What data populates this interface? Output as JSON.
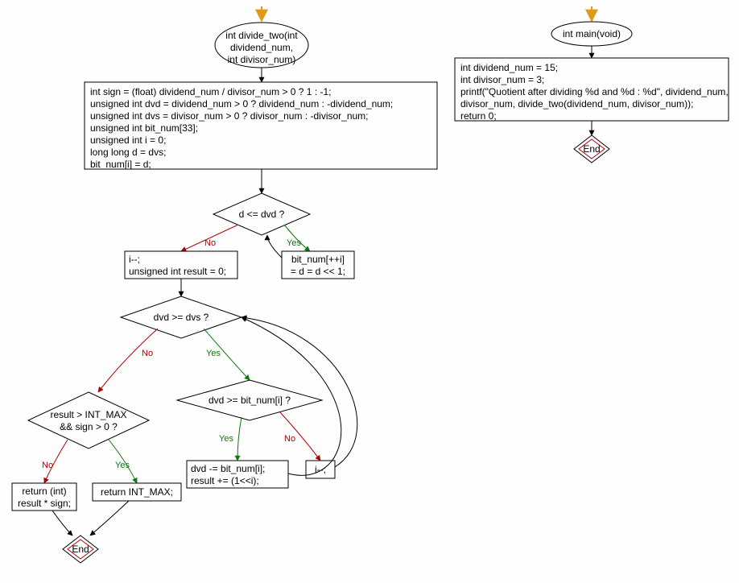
{
  "flowchart_left": {
    "start_arrow": "entry",
    "func_signature": "int divide_two(int\ndividend_num,\nint divisor_num)",
    "init_block": "int sign = (float) dividend_num / divisor_num > 0 ? 1 : -1;\nunsigned int dvd = dividend_num > 0 ? dividend_num : -dividend_num;\nunsigned int dvs = divisor_num > 0 ? divisor_num : -divisor_num;\nunsigned int bit_num[33];\nunsigned int i = 0;\nlong long d = dvs;\nbit_num[i] = d;",
    "cond1": "d <= dvd ?",
    "cond1_yes_block": "bit_num[++i]\n= d = d << 1;",
    "cond1_no_block": "i--;\nunsigned int result = 0;",
    "cond2": "dvd >= dvs ?",
    "cond3": "dvd >= bit_num[i] ?",
    "cond3_yes_block": "dvd -= bit_num[i];\nresult += (1<<i);",
    "cond3_no_block": "i--;",
    "cond4": "result > INT_MAX\n&& sign > 0 ?",
    "cond4_yes_block": "return INT_MAX;",
    "cond4_no_block": "return (int)\nresult * sign;",
    "end": "End"
  },
  "flowchart_right": {
    "func_signature": "int main(void)",
    "body_block": "int dividend_num = 15;\nint divisor_num = 3;\nprintf(\"Quotient after dividing %d and %d : %d\", dividend_num,\ndivisor_num, divide_two(dividend_num, divisor_num));\nreturn 0;",
    "end": "End"
  },
  "labels": {
    "yes": "Yes",
    "no": "No"
  },
  "colors": {
    "outline": "#000000",
    "fill_shape": "#fefefe",
    "yes": "#0a7a0a",
    "no": "#b00000",
    "entry_arrow": "#e09a1a",
    "end_inner": "#b00000"
  },
  "chart_data": {
    "type": "flowchart",
    "functions": [
      {
        "name": "int divide_two(int dividend_num, int divisor_num)",
        "nodes": [
          {
            "id": "init",
            "kind": "process",
            "text": "int sign = (float) dividend_num / divisor_num > 0 ? 1 : -1;\nunsigned int dvd = dividend_num > 0 ? dividend_num : -dividend_num;\nunsigned int dvs = divisor_num > 0 ? divisor_num : -divisor_num;\nunsigned int bit_num[33];\nunsigned int i = 0;\nlong long d = dvs;\nbit_num[i] = d;"
          },
          {
            "id": "c1",
            "kind": "decision",
            "text": "d <= dvd ?"
          },
          {
            "id": "c1y",
            "kind": "process",
            "text": "bit_num[++i] = d = d << 1;"
          },
          {
            "id": "c1n",
            "kind": "process",
            "text": "i--;\nunsigned int result = 0;"
          },
          {
            "id": "c2",
            "kind": "decision",
            "text": "dvd >= dvs ?"
          },
          {
            "id": "c3",
            "kind": "decision",
            "text": "dvd >= bit_num[i] ?"
          },
          {
            "id": "c3y",
            "kind": "process",
            "text": "dvd -= bit_num[i];\nresult += (1<<i);"
          },
          {
            "id": "c3n",
            "kind": "process",
            "text": "i--;"
          },
          {
            "id": "c4",
            "kind": "decision",
            "text": "result > INT_MAX && sign > 0 ?"
          },
          {
            "id": "c4y",
            "kind": "process",
            "text": "return INT_MAX;"
          },
          {
            "id": "c4n",
            "kind": "process",
            "text": "return (int) result * sign;"
          },
          {
            "id": "end",
            "kind": "terminator",
            "text": "End"
          }
        ],
        "edges": [
          {
            "from": "init",
            "to": "c1"
          },
          {
            "from": "c1",
            "to": "c1y",
            "label": "Yes"
          },
          {
            "from": "c1y",
            "to": "c1"
          },
          {
            "from": "c1",
            "to": "c1n",
            "label": "No"
          },
          {
            "from": "c1n",
            "to": "c2"
          },
          {
            "from": "c2",
            "to": "c3",
            "label": "Yes"
          },
          {
            "from": "c3",
            "to": "c3y",
            "label": "Yes"
          },
          {
            "from": "c3",
            "to": "c3n",
            "label": "No"
          },
          {
            "from": "c3y",
            "to": "c2"
          },
          {
            "from": "c3n",
            "to": "c2"
          },
          {
            "from": "c2",
            "to": "c4",
            "label": "No"
          },
          {
            "from": "c4",
            "to": "c4y",
            "label": "Yes"
          },
          {
            "from": "c4",
            "to": "c4n",
            "label": "No"
          },
          {
            "from": "c4y",
            "to": "end"
          },
          {
            "from": "c4n",
            "to": "end"
          }
        ]
      },
      {
        "name": "int main(void)",
        "nodes": [
          {
            "id": "body",
            "kind": "process",
            "text": "int dividend_num = 15;\nint divisor_num = 3;\nprintf(\"Quotient after dividing %d and %d : %d\", dividend_num, divisor_num, divide_two(dividend_num, divisor_num));\nreturn 0;"
          },
          {
            "id": "end",
            "kind": "terminator",
            "text": "End"
          }
        ],
        "edges": [
          {
            "from": "body",
            "to": "end"
          }
        ]
      }
    ]
  }
}
